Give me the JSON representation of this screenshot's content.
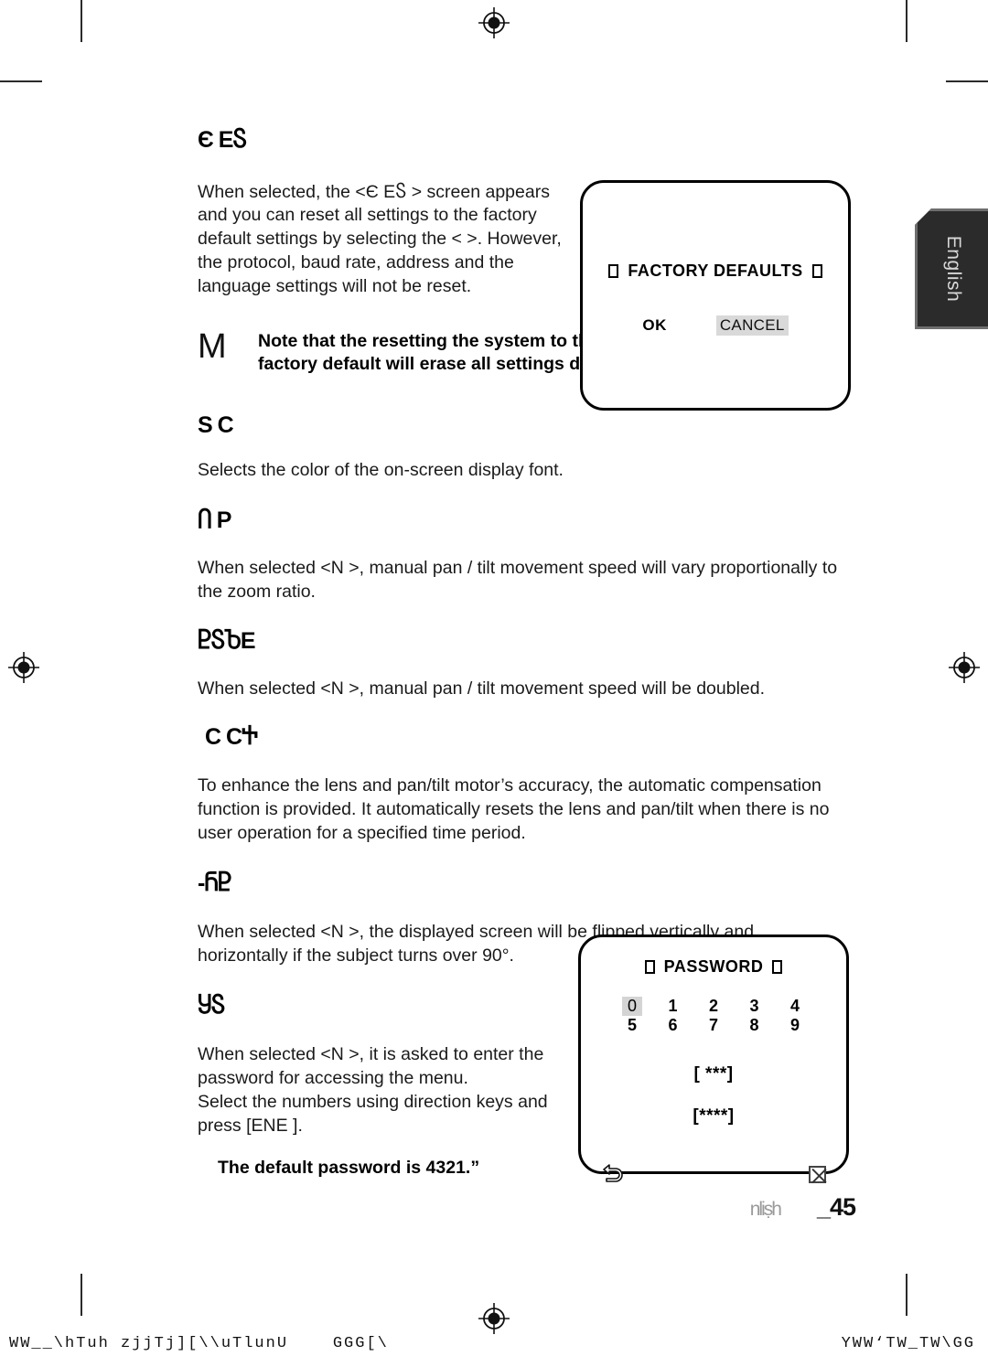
{
  "page": {
    "language_tab": "English",
    "footer_language": "nliṣh",
    "page_number": "_45"
  },
  "sections": [
    {
      "heading": "Є                ЕႽ",
      "paragraph": "When selected, the <Є                ЕႽ               >  screen appears and you can reset all settings to the factory default settings by selecting the <     >. However, the protocol, baud rate, address and the language settings will not be reset."
    },
    {
      "heading": "S C",
      "paragraph": "Selects the color of the on-screen display font."
    },
    {
      "heading": "Ⴖ P",
      "paragraph": "When selected <N   >, manual pan / tilt movement speed will vary proportionally to the zoom ratio."
    },
    {
      "heading": "ႲႽႦЕ",
      "paragraph": "When selected <N   >, manual pan / tilt movement speed will be doubled."
    },
    {
      "heading": " C  CႵ",
      "paragraph": "To enhance the lens and pan/tilt motor’s accuracy, the automatic compensation function is provided. It automatically resets the lens and pan/tilt when there is no user operation for a specified time period."
    },
    {
      "heading": "-ႬႲ",
      "paragraph": "When selected <N   >, the displayed screen will be flipped vertically and horizontally if the subject turns over 90°."
    },
    {
      "heading": "ႸႽ",
      "paragraph_line1": "When selected <N   >, it is asked to enter the password for accessing the menu.",
      "paragraph_line2": "Select the numbers using direction keys and press [ENE     ].",
      "note": "The default password is 4321.”"
    }
  ],
  "note_block": {
    "marker": "M",
    "text": "Note that the resetting the system to the factory default will erase all settings data."
  },
  "factory_dialog": {
    "title": "FACTORY DEFAULTS",
    "ok_label": "OK",
    "cancel_label": "CANCEL"
  },
  "password_dialog": {
    "title": "PASSWORD",
    "keys_row1": [
      "0",
      "1",
      "2",
      "3",
      "4"
    ],
    "keys_row2": [
      "5",
      "6",
      "7",
      "8",
      "9"
    ],
    "selected_key": "0",
    "entry_field": "[ ***]",
    "confirm_field": "[****]",
    "back_icon": "back-arrow-icon",
    "exit_icon": "exit-icon"
  },
  "print_strip": {
    "left": "WW__\\hTuh zjjTj][\\\\uTlunU    GGG[\\",
    "right": "YWW‘TW_TW\\GG"
  },
  "colors": {
    "text": "#1a1a1a",
    "tab_background": "#2b2b2b",
    "tab_border": "#6e6e6e",
    "highlight": "#d9d9d9"
  }
}
